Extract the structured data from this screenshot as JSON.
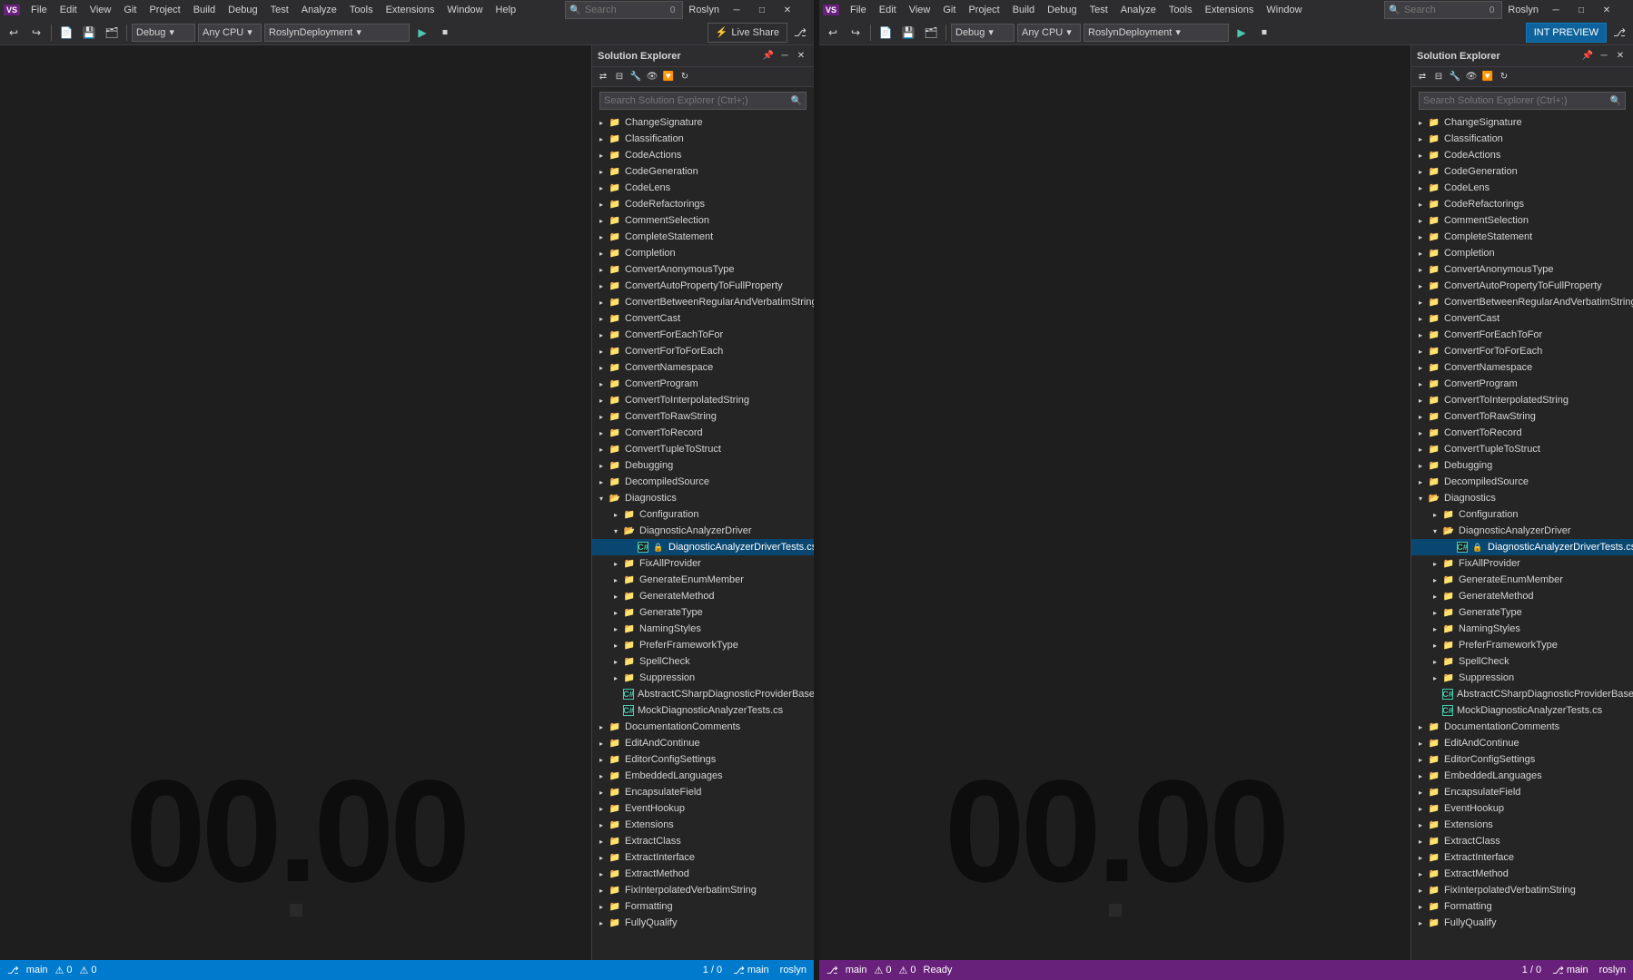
{
  "instances": [
    {
      "id": "left",
      "title": "Roslyn",
      "searchBox": {
        "placeholder": "Search (Ctrl+:)",
        "count": "0"
      },
      "toolbar": {
        "debugMode": "Debug",
        "platform": "Any CPU",
        "project": "RoslynDeployment",
        "liveShare": "Live Share"
      },
      "searchTop": {
        "placeholder": "Search",
        "count": "0"
      },
      "solutionExplorer": {
        "title": "Solution Explorer",
        "searchPlaceholder": "Search Solution Explorer (Ctrl+;)",
        "treeItems": [
          {
            "level": 1,
            "type": "folder",
            "label": "ChangeSignature",
            "expanded": false
          },
          {
            "level": 1,
            "type": "folder",
            "label": "Classification",
            "expanded": false
          },
          {
            "level": 1,
            "type": "folder",
            "label": "CodeActions",
            "expanded": false
          },
          {
            "level": 1,
            "type": "folder",
            "label": "CodeGeneration",
            "expanded": false
          },
          {
            "level": 1,
            "type": "folder",
            "label": "CodeLens",
            "expanded": false
          },
          {
            "level": 1,
            "type": "folder",
            "label": "CodeRefactorings",
            "expanded": false
          },
          {
            "level": 1,
            "type": "folder",
            "label": "CommentSelection",
            "expanded": false
          },
          {
            "level": 1,
            "type": "folder",
            "label": "CompleteStatement",
            "expanded": false
          },
          {
            "level": 1,
            "type": "folder",
            "label": "Completion",
            "expanded": false
          },
          {
            "level": 1,
            "type": "folder",
            "label": "ConvertAnonymousType",
            "expanded": false
          },
          {
            "level": 1,
            "type": "folder",
            "label": "ConvertAutoPropertyToFullProperty",
            "expanded": false
          },
          {
            "level": 1,
            "type": "folder",
            "label": "ConvertBetweenRegularAndVerbatimString",
            "expanded": false
          },
          {
            "level": 1,
            "type": "folder",
            "label": "ConvertCast",
            "expanded": false
          },
          {
            "level": 1,
            "type": "folder",
            "label": "ConvertForEachToFor",
            "expanded": false
          },
          {
            "level": 1,
            "type": "folder",
            "label": "ConvertForToForEach",
            "expanded": false
          },
          {
            "level": 1,
            "type": "folder",
            "label": "ConvertNamespace",
            "expanded": false
          },
          {
            "level": 1,
            "type": "folder",
            "label": "ConvertProgram",
            "expanded": false
          },
          {
            "level": 1,
            "type": "folder",
            "label": "ConvertToInterpolatedString",
            "expanded": false
          },
          {
            "level": 1,
            "type": "folder",
            "label": "ConvertToRawString",
            "expanded": false
          },
          {
            "level": 1,
            "type": "folder",
            "label": "ConvertToRecord",
            "expanded": false
          },
          {
            "level": 1,
            "type": "folder",
            "label": "ConvertTupleToStruct",
            "expanded": false
          },
          {
            "level": 1,
            "type": "folder",
            "label": "Debugging",
            "expanded": false
          },
          {
            "level": 1,
            "type": "folder",
            "label": "DecompiledSource",
            "expanded": false
          },
          {
            "level": 1,
            "type": "folder",
            "label": "Diagnostics",
            "expanded": true
          },
          {
            "level": 2,
            "type": "folder",
            "label": "Configuration",
            "expanded": false
          },
          {
            "level": 2,
            "type": "folder",
            "label": "DiagnosticAnalyzerDriver",
            "expanded": true
          },
          {
            "level": 3,
            "type": "csfile",
            "label": "DiagnosticAnalyzerDriverTests.cs",
            "selected": true
          },
          {
            "level": 2,
            "type": "folder",
            "label": "FixAllProvider",
            "expanded": false
          },
          {
            "level": 2,
            "type": "folder",
            "label": "GenerateEnumMember",
            "expanded": false
          },
          {
            "level": 2,
            "type": "folder",
            "label": "GenerateMethod",
            "expanded": false
          },
          {
            "level": 2,
            "type": "folder",
            "label": "GenerateType",
            "expanded": false
          },
          {
            "level": 2,
            "type": "folder",
            "label": "NamingStyles",
            "expanded": false
          },
          {
            "level": 2,
            "type": "folder",
            "label": "PreferFrameworkType",
            "expanded": false
          },
          {
            "level": 2,
            "type": "folder",
            "label": "SpellCheck",
            "expanded": false
          },
          {
            "level": 2,
            "type": "folder",
            "label": "Suppression",
            "expanded": false
          },
          {
            "level": 2,
            "type": "csfile",
            "label": "AbstractCSharpDiagnosticProviderBased",
            "expanded": false
          },
          {
            "level": 2,
            "type": "csfile",
            "label": "MockDiagnosticAnalyzerTests.cs",
            "expanded": false
          },
          {
            "level": 1,
            "type": "folder",
            "label": "DocumentationComments",
            "expanded": false
          },
          {
            "level": 1,
            "type": "folder",
            "label": "EditAndContinue",
            "expanded": false
          },
          {
            "level": 1,
            "type": "folder",
            "label": "EditorConfigSettings",
            "expanded": false
          },
          {
            "level": 1,
            "type": "folder",
            "label": "EmbeddedLanguages",
            "expanded": false
          },
          {
            "level": 1,
            "type": "folder",
            "label": "EncapsulateField",
            "expanded": false
          },
          {
            "level": 1,
            "type": "folder",
            "label": "EventHookup",
            "expanded": false
          },
          {
            "level": 1,
            "type": "folder",
            "label": "Extensions",
            "expanded": false
          },
          {
            "level": 1,
            "type": "folder",
            "label": "ExtractClass",
            "expanded": false
          },
          {
            "level": 1,
            "type": "folder",
            "label": "ExtractInterface",
            "expanded": false
          },
          {
            "level": 1,
            "type": "folder",
            "label": "ExtractMethod",
            "expanded": false
          },
          {
            "level": 1,
            "type": "folder",
            "label": "FixInterpolatedVerbatimString",
            "expanded": false
          },
          {
            "level": 1,
            "type": "folder",
            "label": "Formatting",
            "expanded": false
          },
          {
            "level": 1,
            "type": "folder",
            "label": "FullyQualify",
            "expanded": false
          }
        ]
      },
      "statusBar": {
        "branch": "main",
        "user": "roslyn",
        "lineCol": "1 / 0",
        "errors": "0",
        "warnings": "0",
        "ready": ""
      }
    },
    {
      "id": "right",
      "title": "Roslyn",
      "searchBox": {
        "placeholder": "Search (Ctrl+:)",
        "count": "0"
      },
      "toolbar": {
        "debugMode": "Debug",
        "platform": "Any CPU",
        "project": "RoslynDeployment",
        "intPreview": "INT PREVIEW"
      },
      "searchTop": {
        "placeholder": "Search",
        "count": "0"
      },
      "solutionExplorer": {
        "title": "Solution Explorer",
        "searchPlaceholder": "Search Solution Explorer (Ctrl+;)",
        "treeItems": [
          {
            "level": 1,
            "type": "folder",
            "label": "ChangeSignature",
            "expanded": false
          },
          {
            "level": 1,
            "type": "folder",
            "label": "Classification",
            "expanded": false
          },
          {
            "level": 1,
            "type": "folder",
            "label": "CodeActions",
            "expanded": false
          },
          {
            "level": 1,
            "type": "folder",
            "label": "CodeGeneration",
            "expanded": false
          },
          {
            "level": 1,
            "type": "folder",
            "label": "CodeLens",
            "expanded": false
          },
          {
            "level": 1,
            "type": "folder",
            "label": "CodeRefactorings",
            "expanded": false
          },
          {
            "level": 1,
            "type": "folder",
            "label": "CommentSelection",
            "expanded": false
          },
          {
            "level": 1,
            "type": "folder",
            "label": "CompleteStatement",
            "expanded": false
          },
          {
            "level": 1,
            "type": "folder",
            "label": "Completion",
            "expanded": false
          },
          {
            "level": 1,
            "type": "folder",
            "label": "ConvertAnonymousType",
            "expanded": false
          },
          {
            "level": 1,
            "type": "folder",
            "label": "ConvertAutoPropertyToFullProperty",
            "expanded": false
          },
          {
            "level": 1,
            "type": "folder",
            "label": "ConvertBetweenRegularAndVerbatimString",
            "expanded": false
          },
          {
            "level": 1,
            "type": "folder",
            "label": "ConvertCast",
            "expanded": false
          },
          {
            "level": 1,
            "type": "folder",
            "label": "ConvertForEachToFor",
            "expanded": false
          },
          {
            "level": 1,
            "type": "folder",
            "label": "ConvertForToForEach",
            "expanded": false
          },
          {
            "level": 1,
            "type": "folder",
            "label": "ConvertNamespace",
            "expanded": false
          },
          {
            "level": 1,
            "type": "folder",
            "label": "ConvertProgram",
            "expanded": false
          },
          {
            "level": 1,
            "type": "folder",
            "label": "ConvertToInterpolatedString",
            "expanded": false
          },
          {
            "level": 1,
            "type": "folder",
            "label": "ConvertToRawString",
            "expanded": false
          },
          {
            "level": 1,
            "type": "folder",
            "label": "ConvertToRecord",
            "expanded": false
          },
          {
            "level": 1,
            "type": "folder",
            "label": "ConvertTupleToStruct",
            "expanded": false
          },
          {
            "level": 1,
            "type": "folder",
            "label": "Debugging",
            "expanded": false
          },
          {
            "level": 1,
            "type": "folder",
            "label": "DecompiledSource",
            "expanded": false
          },
          {
            "level": 1,
            "type": "folder",
            "label": "Diagnostics",
            "expanded": true
          },
          {
            "level": 2,
            "type": "folder",
            "label": "Configuration",
            "expanded": false
          },
          {
            "level": 2,
            "type": "folder",
            "label": "DiagnosticAnalyzerDriver",
            "expanded": true
          },
          {
            "level": 3,
            "type": "csfile",
            "label": "DiagnosticAnalyzerDriverTests.cs",
            "selected": true
          },
          {
            "level": 2,
            "type": "folder",
            "label": "FixAllProvider",
            "expanded": false
          },
          {
            "level": 2,
            "type": "folder",
            "label": "GenerateEnumMember",
            "expanded": false
          },
          {
            "level": 2,
            "type": "folder",
            "label": "GenerateMethod",
            "expanded": false
          },
          {
            "level": 2,
            "type": "folder",
            "label": "GenerateType",
            "expanded": false
          },
          {
            "level": 2,
            "type": "folder",
            "label": "NamingStyles",
            "expanded": false
          },
          {
            "level": 2,
            "type": "folder",
            "label": "PreferFrameworkType",
            "expanded": false
          },
          {
            "level": 2,
            "type": "folder",
            "label": "SpellCheck",
            "expanded": false
          },
          {
            "level": 2,
            "type": "folder",
            "label": "Suppression",
            "expanded": false
          },
          {
            "level": 2,
            "type": "csfile",
            "label": "AbstractCSharpDiagnosticProviderBase",
            "expanded": false
          },
          {
            "level": 2,
            "type": "csfile",
            "label": "MockDiagnosticAnalyzerTests.cs",
            "expanded": false
          },
          {
            "level": 1,
            "type": "folder",
            "label": "DocumentationComments",
            "expanded": false
          },
          {
            "level": 1,
            "type": "folder",
            "label": "EditAndContinue",
            "expanded": false
          },
          {
            "level": 1,
            "type": "folder",
            "label": "EditorConfigSettings",
            "expanded": false
          },
          {
            "level": 1,
            "type": "folder",
            "label": "EmbeddedLanguages",
            "expanded": false
          },
          {
            "level": 1,
            "type": "folder",
            "label": "EncapsulateField",
            "expanded": false
          },
          {
            "level": 1,
            "type": "folder",
            "label": "EventHookup",
            "expanded": false
          },
          {
            "level": 1,
            "type": "folder",
            "label": "Extensions",
            "expanded": false
          },
          {
            "level": 1,
            "type": "folder",
            "label": "ExtractClass",
            "expanded": false
          },
          {
            "level": 1,
            "type": "folder",
            "label": "ExtractInterface",
            "expanded": false
          },
          {
            "level": 1,
            "type": "folder",
            "label": "ExtractMethod",
            "expanded": false
          },
          {
            "level": 1,
            "type": "folder",
            "label": "FixInterpolatedVerbatimString",
            "expanded": false
          },
          {
            "level": 1,
            "type": "folder",
            "label": "Formatting",
            "expanded": false
          },
          {
            "level": 1,
            "type": "folder",
            "label": "FullyQualify",
            "expanded": false
          }
        ]
      },
      "statusBar": {
        "branch": "main",
        "user": "roslyn",
        "lineCol": "1 / 0",
        "errors": "0",
        "warnings": "0",
        "ready": "Ready"
      }
    }
  ],
  "labels": {
    "menuItems_left": [
      "File",
      "Edit",
      "View",
      "Git",
      "Project",
      "Build",
      "Debug",
      "Test",
      "Analyze",
      "Tools",
      "Extensions",
      "Window",
      "Help"
    ],
    "menuItems_right": [
      "File",
      "Edit",
      "View",
      "Git",
      "Project",
      "Build",
      "Debug",
      "Test",
      "Analyze",
      "Tools",
      "Extensions",
      "Window"
    ],
    "watermark": "00.00",
    "searchLabel": "Search :",
    "cpuLabel": "CPU"
  }
}
